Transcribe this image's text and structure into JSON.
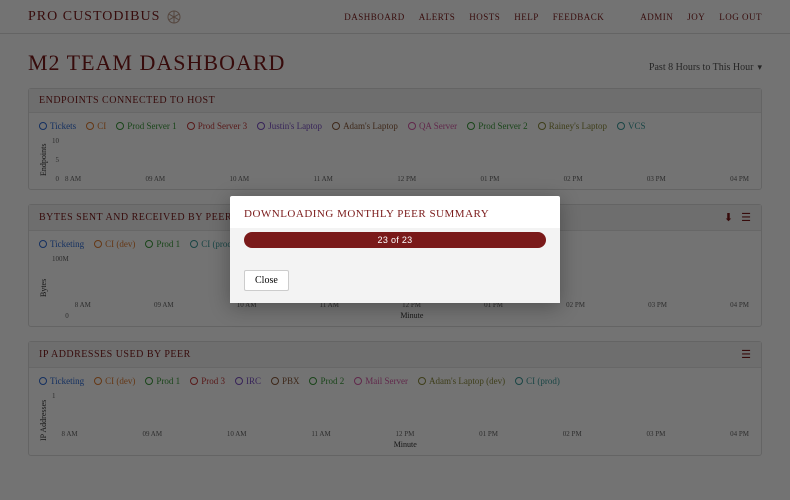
{
  "brand": "PRO CUSTODIBUS",
  "nav": {
    "dashboard": "DASHBOARD",
    "alerts": "ALERTS",
    "hosts": "HOSTS",
    "help": "HELP",
    "feedback": "FEEDBACK",
    "admin": "ADMIN",
    "joy": "JOY",
    "logout": "LOG OUT"
  },
  "page_title": "M2 TEAM DASHBOARD",
  "range": {
    "label": "Past 8 Hours to This Hour"
  },
  "panels": {
    "endpoints": {
      "title": "ENDPOINTS CONNECTED TO HOST",
      "ylabel": "Endpoints",
      "legend": [
        {
          "label": "Tickets",
          "color": "c-blue"
        },
        {
          "label": "CI",
          "color": "c-orange"
        },
        {
          "label": "Prod Server 1",
          "color": "c-green"
        },
        {
          "label": "Prod Server 3",
          "color": "c-red"
        },
        {
          "label": "Justin's Laptop",
          "color": "c-purple"
        },
        {
          "label": "Adam's Laptop",
          "color": "c-brown"
        },
        {
          "label": "QA Server",
          "color": "c-pink"
        },
        {
          "label": "Prod Server 2",
          "color": "c-green"
        },
        {
          "label": "Rainey's Laptop",
          "color": "c-olive"
        },
        {
          "label": "VCS",
          "color": "c-teal"
        }
      ]
    },
    "bytes": {
      "title": "BYTES SENT AND RECEIVED BY PEER",
      "ylabel": "Bytes",
      "xlabel": "Minute",
      "legend": [
        {
          "label": "Ticketing",
          "color": "c-blue"
        },
        {
          "label": "CI (dev)",
          "color": "c-orange"
        },
        {
          "label": "Prod 1",
          "color": "c-green"
        },
        {
          "label": "CI (prod)",
          "color": "c-teal"
        }
      ]
    },
    "ips": {
      "title": "IP ADDRESSES USED BY PEER",
      "ylabel": "IP Addresses",
      "xlabel": "Minute",
      "legend": [
        {
          "label": "Ticketing",
          "color": "c-blue"
        },
        {
          "label": "CI (dev)",
          "color": "c-orange"
        },
        {
          "label": "Prod 1",
          "color": "c-green"
        },
        {
          "label": "Prod 3",
          "color": "c-red"
        },
        {
          "label": "IRC",
          "color": "c-purple"
        },
        {
          "label": "PBX",
          "color": "c-brown"
        },
        {
          "label": "Prod 2",
          "color": "c-green"
        },
        {
          "label": "Mail Server",
          "color": "c-pink"
        },
        {
          "label": "Adam's Laptop (dev)",
          "color": "c-olive"
        },
        {
          "label": "CI (prod)",
          "color": "c-teal"
        }
      ]
    }
  },
  "xaxis": [
    "8 AM",
    "09 AM",
    "10 AM",
    "11 AM",
    "12 PM",
    "01 PM",
    "02 PM",
    "03 PM",
    "04 PM"
  ],
  "modal": {
    "title": "DOWNLOADING MONTHLY PEER SUMMARY",
    "progress": "23 of 23",
    "close": "Close"
  },
  "chart_data": [
    {
      "type": "bar",
      "title": "Endpoints Connected to Host",
      "ylabel": "Endpoints",
      "ylim": [
        0,
        10
      ],
      "x_range": [
        "08:00",
        "16:00"
      ],
      "note": "stacked per-minute bars across 10 hosts; values fluctuate 0–10"
    },
    {
      "type": "bar",
      "title": "Bytes Sent and Received by Peer",
      "ylabel": "Bytes",
      "xlabel": "Minute",
      "ylim": [
        0,
        100000000
      ],
      "ytick_top": "100M",
      "x_range": [
        "08:00",
        "16:00"
      ],
      "note": "stacked per-minute bars; multiple peer series"
    },
    {
      "type": "bar",
      "title": "IP Addresses Used by Peer",
      "ylabel": "IP Addresses",
      "xlabel": "Minute",
      "x_range": [
        "08:00",
        "16:00"
      ],
      "note": "stacked per-minute bars across peers"
    }
  ]
}
